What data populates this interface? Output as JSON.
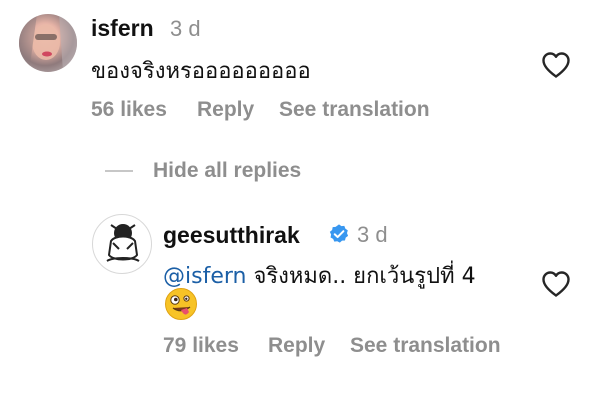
{
  "comments": [
    {
      "username": "isfern",
      "time": "3 d",
      "text": "ของจริงหรอออออออออ",
      "likes": "56 likes",
      "reply": "Reply",
      "see_translation": "See translation",
      "icon": "heart-outline-icon"
    }
  ],
  "thread": {
    "toggle_label": "Hide all replies"
  },
  "reply": {
    "username": "geesutthirak",
    "verified_icon": "verified-badge-icon",
    "time": "3 d",
    "mention": "@isfern",
    "text": " จริงหมด.. ยกเว้นรูปที่ 4",
    "emoji": "🤪",
    "likes": "79 likes",
    "reply": "Reply",
    "see_translation": "See translation",
    "icon": "heart-outline-icon"
  },
  "colors": {
    "text": "#111111",
    "muted": "#8e8e8e",
    "mention": "#1b5fa6",
    "verified": "#3897f0"
  }
}
